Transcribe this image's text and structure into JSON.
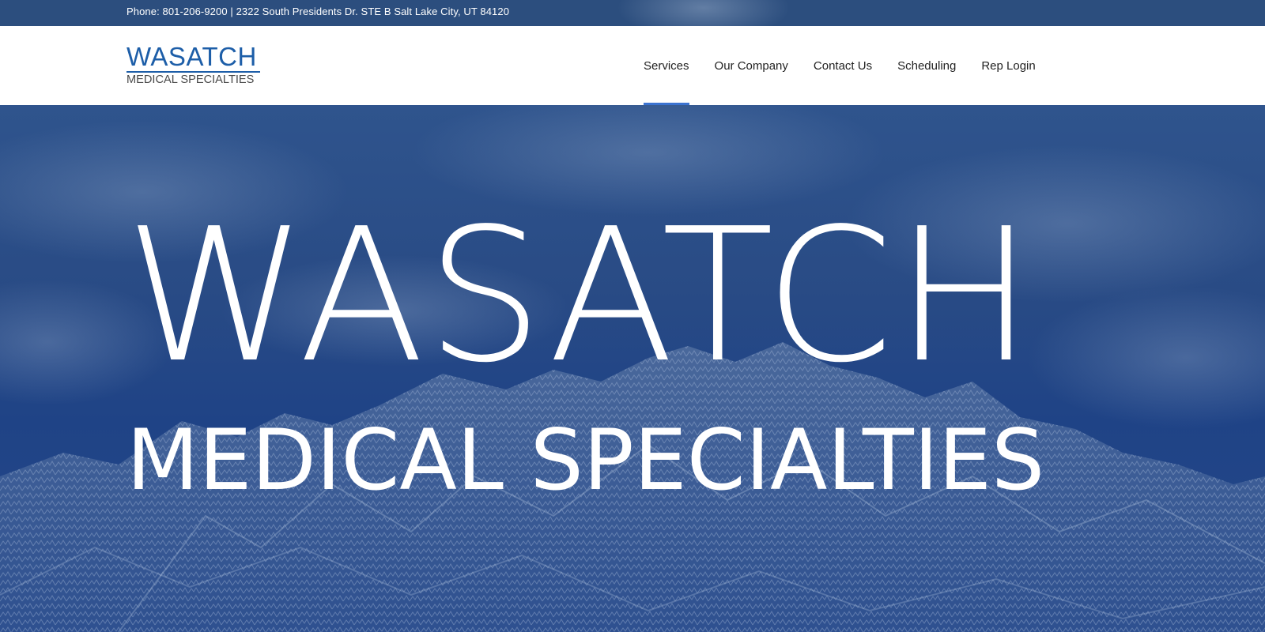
{
  "topbar": {
    "contact_text": "Phone: 801-206-9200 | 2322 South Presidents Dr. STE B Salt Lake City, UT 84120"
  },
  "logo": {
    "main": "WASATCH",
    "sub": "MEDICAL SPECIALTIES",
    "color": "#1d5ea8"
  },
  "nav": {
    "items": [
      {
        "label": "Services",
        "active": true
      },
      {
        "label": "Our Company",
        "active": false
      },
      {
        "label": "Contact Us",
        "active": false
      },
      {
        "label": "Scheduling",
        "active": false
      },
      {
        "label": "Rep Login",
        "active": false
      }
    ],
    "active_color": "#3b73d1"
  },
  "hero": {
    "title": "WASATCH",
    "subtitle": "MEDICAL SPECIALTIES",
    "overlay_color": "#26488a"
  }
}
